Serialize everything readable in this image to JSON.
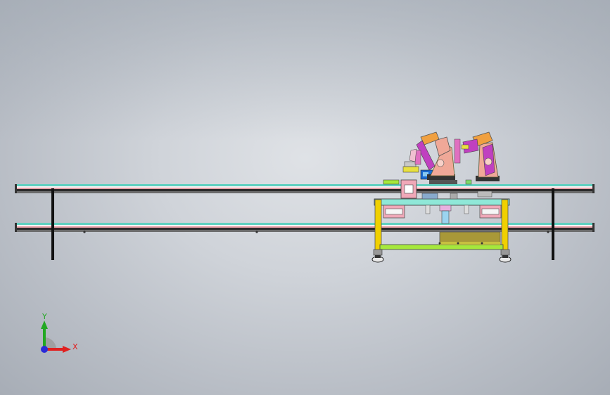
{
  "triad": {
    "y_label": "Y",
    "x_label": "X",
    "y_color": "#22a822",
    "x_color": "#e02020",
    "z_color": "#2a2ad8"
  },
  "colors": {
    "rail_teal": "#5fd0c0",
    "rail_pink": "#e8a0a8",
    "frame_yellow": "#f0d000",
    "frame_green": "#a6e83c",
    "plate_teal": "#8fe8d8",
    "robot_salmon": "#f0a898",
    "robot_magenta": "#c040c0",
    "robot_orange": "#f0a040",
    "panel_olive": "#a89838",
    "block_pink": "#f0a8b8",
    "support_black": "#111111"
  }
}
